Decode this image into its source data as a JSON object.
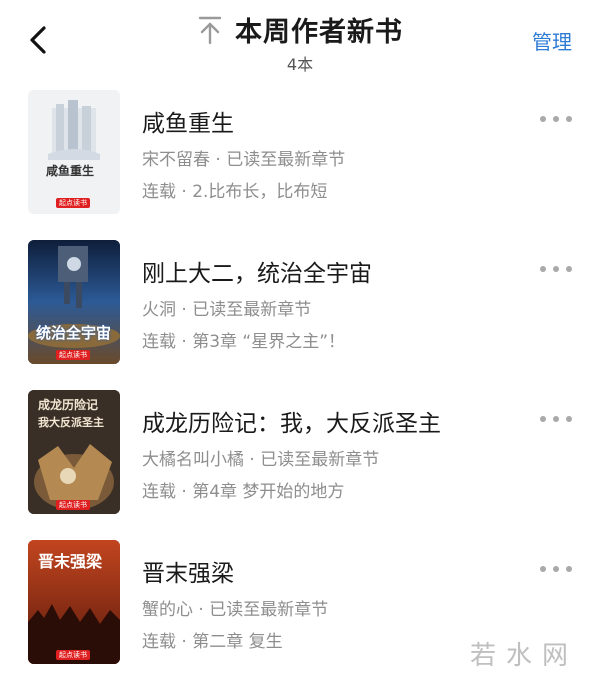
{
  "header": {
    "title": "本周作者新书",
    "count": "4本",
    "manage_label": "管理"
  },
  "books": [
    {
      "title": "咸鱼重生",
      "author_line": "宋不留春 · 已读至最新章节",
      "status_line": "连载 · 2.比布长，比布短",
      "cover": {
        "title": "咸鱼重生",
        "badge": "起点读书",
        "bg": "#eef0f2"
      }
    },
    {
      "title": "刚上大二，统治全宇宙",
      "author_line": "火洞 · 已读至最新章节",
      "status_line": "连载 · 第3章 “星界之主”！",
      "cover": {
        "title": "统治全宇宙",
        "badge": "起点读书",
        "bg": "#1b3e73"
      }
    },
    {
      "title": "成龙历险记：我，大反派圣主",
      "author_line": "大橘名叫小橘 · 已读至最新章节",
      "status_line": "连载 · 第4章 梦开始的地方",
      "cover": {
        "title_line1": "成龙历险记",
        "title_line2": "我大反派圣主",
        "badge": "起点读书",
        "bg": "#2e2620"
      }
    },
    {
      "title": "晋末强梁",
      "author_line": "蟹的心 · 已读至最新章节",
      "status_line": "连载 · 第二章 复生",
      "cover": {
        "title": "晋末强梁",
        "badge": "起点读书",
        "bg": "#b23a1c"
      }
    }
  ],
  "watermark": "若水网",
  "colors": {
    "accent": "#2f7cd6",
    "title": "#1a1a1a",
    "meta": "#8e8e8e"
  }
}
